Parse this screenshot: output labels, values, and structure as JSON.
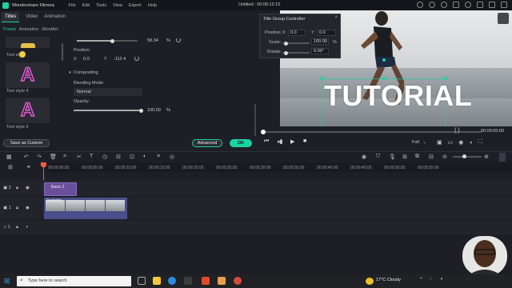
{
  "titlebar": {
    "app_name": "Wondershare Filmora",
    "menu": [
      "File",
      "Edit",
      "Tools",
      "View",
      "Export",
      "Help"
    ],
    "document": "Untitled : 00:00:12:15"
  },
  "top_tabs": [
    "Titles",
    "Video",
    "Animation"
  ],
  "sub_tabs": [
    "Preset",
    "Animation",
    "WordArt"
  ],
  "presets": [
    {
      "label": "Text style",
      "glyph": ""
    },
    {
      "label": "Text style 4",
      "glyph": "A"
    },
    {
      "label": "Text style 5",
      "glyph": "A"
    }
  ],
  "properties": {
    "first_value": "58.34",
    "first_unit": "%",
    "position_label": "Position:",
    "pos_x_label": "X",
    "pos_x": "0.0",
    "pos_y_label": "Y",
    "pos_y": "-112.4",
    "compositing_label": "Compositing",
    "blend_label": "Blending Mode:",
    "blend_value": "Normal",
    "opacity_label": "Opacity:",
    "opacity_value": "100.00",
    "opacity_unit": "%",
    "first_level": 0.58,
    "opacity_level": 1.0
  },
  "buttons": {
    "save_custom": "Save as Custom",
    "advanced": "Advanced",
    "ok": "OK"
  },
  "preview": {
    "overlay_text": "TUTORIAL"
  },
  "title_group_controller": {
    "title": "Title Group Controller",
    "position_label": "Position:",
    "x_label": "X",
    "x_value": "0.0",
    "y_label": "Y",
    "y_value": "0.0",
    "scale_label": "Scale:",
    "scale_value": "100.00",
    "scale_unit": "%",
    "rotate_label": "Rotate:",
    "rotate_value": "0.00°"
  },
  "playback": {
    "timecode": "00:00:00:00",
    "braces": "{   }",
    "quality": "Full",
    "progress": 0.0
  },
  "timeline": {
    "ruler": [
      "00:00:00:00",
      "00:00:05:00",
      "00:00:10:00",
      "00:00:15:00",
      "00:00:20:00",
      "00:00:25:00",
      "00:00:30:00",
      "00:00:35:00",
      "00:00:40:00",
      "00:00:45:00",
      "00:00:50:00",
      "00:00:55:00"
    ],
    "tracks": [
      {
        "label": "2",
        "clip": "Basic 2"
      },
      {
        "label": "1",
        "clip": "Running"
      },
      {
        "label": "1",
        "clip": ""
      }
    ],
    "zoom_level": 0.4
  },
  "taskbar": {
    "search_placeholder": "Type here to search",
    "weather": "17°C  Cloudy"
  },
  "colors": {
    "accent": "#19d4a0",
    "playhead": "#ff5a3c",
    "title_clip": "#6a4f9c",
    "video_clip": "#4a4e8a"
  }
}
